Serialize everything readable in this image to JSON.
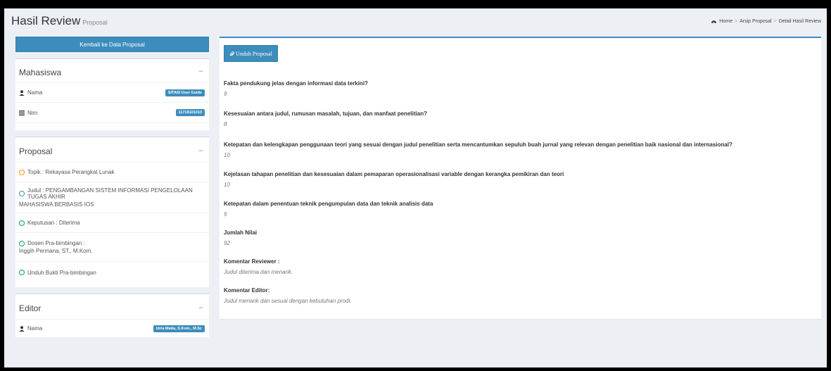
{
  "header": {
    "title": "Hasil Review",
    "subtitle": "Proposal",
    "breadcrumb": [
      "Home",
      "Arsip Proposal",
      "Detail Hasil Review"
    ]
  },
  "left": {
    "back_button": "Kembali ke Data Proposal",
    "mahasiswa": {
      "title": "Mahasiswa",
      "toggle": "−",
      "nama_label": "Nama",
      "nama_value": "SITASI User Guide",
      "nim_label": "Nim",
      "nim_value": "11718101010"
    },
    "proposal": {
      "title": "Proposal",
      "toggle": "−",
      "items": [
        {
          "text": "Topik : Rekayasa Perangkat Lunak",
          "color": "#f39c12"
        },
        {
          "text": "Judul : PENGAMBANGAN SISTEM INFORMASI PENGELOLAAN TUGAS AKHIR",
          "text2": "MAHASISWA BERBASIS IOS",
          "color": "#3c8dbc"
        },
        {
          "text": "Keputusan : Diterima",
          "color": "#00a65a"
        },
        {
          "text": "Dosen Pra-bimbingan :",
          "text2": "Inggih Permana, ST., M.Kom.",
          "color": "#00a65a"
        },
        {
          "text": "Unduh Bukti Pra-bimbingan",
          "color": "#00a65a"
        }
      ]
    },
    "editor": {
      "title": "Editor",
      "toggle": "−",
      "nama_label": "Nama",
      "nama_value": "Idria Maita, S.Kom., M.Sc"
    }
  },
  "main": {
    "download_button": "Unduh Proposal",
    "qa": [
      {
        "q": "Fakta pendukung jelas dengan informasi data terkini?",
        "a": "9"
      },
      {
        "q": "Kesesuaian antara judul, rumusan masalah, tujuan, dan manfaat penelitian?",
        "a": "8"
      },
      {
        "q": "Ketepatan dan kelengkapan penggunaan teori yang sesuai dengan judul penelitian serta mencantumkan sepuluh buah jurnal yang relevan dengan penelitian baik nasional dan internasional?",
        "a": "10"
      },
      {
        "q": "Kejelasan tahapan penelitian dan kesesuaian dalam pemaparan operasionalisasi variable dengan kerangka pemikiran dan teori",
        "a": "10"
      },
      {
        "q": "Ketepatan dalam penentuan teknik pengumpulan data dan teknik analisis data",
        "a": "9"
      },
      {
        "q": "Jumlah Nilai",
        "a": "92"
      },
      {
        "q": "Komentar Reviewer :",
        "a": "Judul diterima dan menarik."
      },
      {
        "q": "Komentar Editor:",
        "a": "Judul menarik dan sesuai dengan kebutuhan prodi."
      }
    ]
  },
  "colors": {
    "accent": "#3c8dbc",
    "orange": "#f39c12",
    "green": "#00a65a"
  }
}
